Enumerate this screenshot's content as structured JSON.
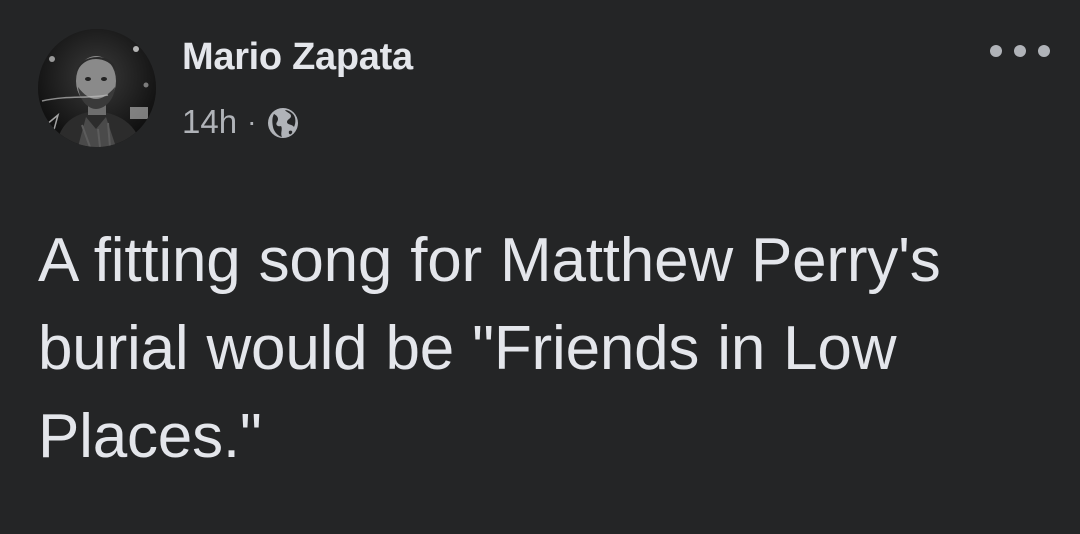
{
  "post": {
    "author_name": "Mario Zapata",
    "timestamp": "14h",
    "separator": "·",
    "audience_icon": "globe-icon",
    "more_icon": "more-options-icon",
    "text": "A fitting song for Matthew Perry's burial would be \"Friends in Low Places.\""
  },
  "colors": {
    "background": "#242526",
    "primary_text": "#e4e6eb",
    "secondary_text": "#b0b3b8"
  }
}
